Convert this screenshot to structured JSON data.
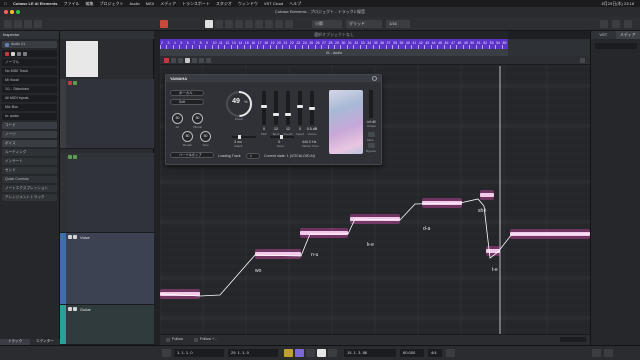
{
  "menubar": {
    "app": "Cubase LE AI Elements",
    "items": [
      "ファイル",
      "編集",
      "プロジェクト",
      "Audio",
      "MIDI",
      "メディア",
      "トランスポート",
      "スタジオ",
      "ウィンドウ",
      "VST Cloud",
      "ヘルプ"
    ],
    "clock": "8月29日(木) 23:18"
  },
  "titlebar": {
    "title": "Cubase Elements - プロジェクト - トラック2 録音"
  },
  "toolbar": {
    "snap_mode": "グリッド",
    "quantize": "1/16",
    "track_label": "小節"
  },
  "statusline": {
    "text": "選択オブジェクトなし"
  },
  "inspector": {
    "header": "Inspector",
    "track_name": "Audio 01",
    "rows": [
      "ノーマル",
      "No MIDI Track",
      "Mi Vocal",
      "1/1 - Sidechain",
      "All MIDI Inputs",
      "Mix Bus",
      "In: audio",
      "コード",
      "ノーツ",
      "ボイス"
    ],
    "sections": [
      "ルーティング",
      "インサート",
      "センド",
      "Quick Controls",
      "ノートエクスプレッション",
      "アレンジメントトラック"
    ],
    "footer_tabs": [
      "トラック",
      "エディター"
    ]
  },
  "tracks": [
    {
      "name": "",
      "color": "#3a3d42"
    },
    {
      "name": "",
      "color": "#2e3136"
    },
    {
      "name": "Voice",
      "color": "#3e6fa8"
    },
    {
      "name": "Guitar",
      "color": "#2aa198"
    }
  ],
  "ruler": {
    "bars": [
      "2",
      "3",
      "4",
      "5",
      "6",
      "7",
      "8",
      "9",
      "10",
      "11",
      "12",
      "13",
      "14",
      "15",
      "16",
      "17",
      "18",
      "19",
      "20",
      "21",
      "22",
      "23",
      "24",
      "25",
      "26",
      "27",
      "28",
      "29",
      "30",
      "31",
      "32",
      "33",
      "34",
      "35",
      "36",
      "37",
      "38",
      "39",
      "40",
      "41",
      "42",
      "43",
      "44",
      "45",
      "46",
      "47",
      "48",
      "49",
      "50",
      "51",
      "52",
      "53",
      "54",
      "55"
    ],
    "lower_label": "01 - Audio"
  },
  "editor_toolbar": {
    "label": "ツール"
  },
  "plugin": {
    "brand": "YAMAHA",
    "dropdowns": [
      "ボーカル",
      "Soft",
      "ハード&ポップ"
    ],
    "percent": "49",
    "percent_label": "Power",
    "knobs": [
      {
        "value": "50",
        "label": "Air"
      },
      {
        "value": "50",
        "label": "Vibrato"
      },
      {
        "value": "50",
        "label": "Breath"
      },
      {
        "value": "50",
        "label": "Tone"
      }
    ],
    "faders": [
      {
        "value": "0",
        "label": "Pitch",
        "level": 0.55
      },
      {
        "value": "12",
        "label": "Bend",
        "level": 0.3
      },
      {
        "value": "12",
        "label": "Smooth",
        "level": 0.3
      },
      {
        "value": "0",
        "label": "Speed",
        "level": 0.55
      },
      {
        "value": "0.5 dB",
        "label": "Volume",
        "level": 0.5
      }
    ],
    "attack": {
      "value": "3 ms",
      "label": "Attack"
    },
    "sens": {
      "value": "5",
      "label": "Sens"
    },
    "reverb": {
      "value": "440.0 Hz",
      "label": "Master Tune"
    },
    "loading_label": "Loading Track",
    "loading_value": "1",
    "current_state": "Current state: 1 (VOCALOID AI)",
    "right_value": "-inf dB",
    "right_label": "Output",
    "side_buttons": [
      "Mute",
      "Bypass"
    ]
  },
  "lyrics": [
    {
      "text": "wo"
    },
    {
      "text": "n-u"
    },
    {
      "text": "k-e"
    },
    {
      "text": "d-a"
    },
    {
      "text": "sh-i"
    },
    {
      "text": "t-e"
    }
  ],
  "right_panel": {
    "tabs": [
      "VST",
      "メディア"
    ]
  },
  "editor_footer": {
    "left": "Follow",
    "right": "Follow + -"
  },
  "transport": {
    "left_locator": "1. 1. 1. 0",
    "right_locator": "29. 1. 1. 0",
    "position": "15. 1. 3. 86",
    "tempo": "60.000",
    "signature": "4/4"
  }
}
